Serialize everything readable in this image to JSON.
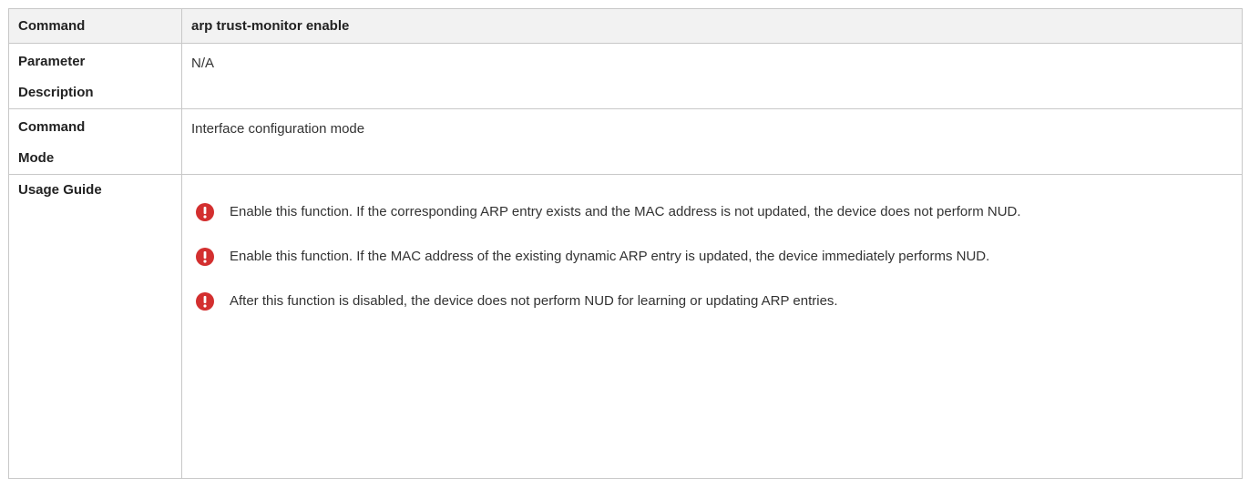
{
  "rows": [
    {
      "label": "Command",
      "value": "arp trust-monitor enable"
    },
    {
      "label_line1": "Parameter",
      "label_line2": "Description",
      "value": "N/A"
    },
    {
      "label_line1": "Command",
      "label_line2": "Mode",
      "value": "Interface configuration mode"
    }
  ],
  "usage": {
    "label": "Usage Guide",
    "icon": "warning-icon",
    "icon_color": "#d32f2f",
    "notes": [
      "Enable this function. If the corresponding ARP entry exists and the MAC address is not updated, the device does not perform NUD.",
      "Enable this function. If the MAC address of the existing dynamic ARP entry is updated, the device immediately performs NUD.",
      "After this function is disabled, the device does not perform NUD for learning or updating ARP entries."
    ]
  }
}
